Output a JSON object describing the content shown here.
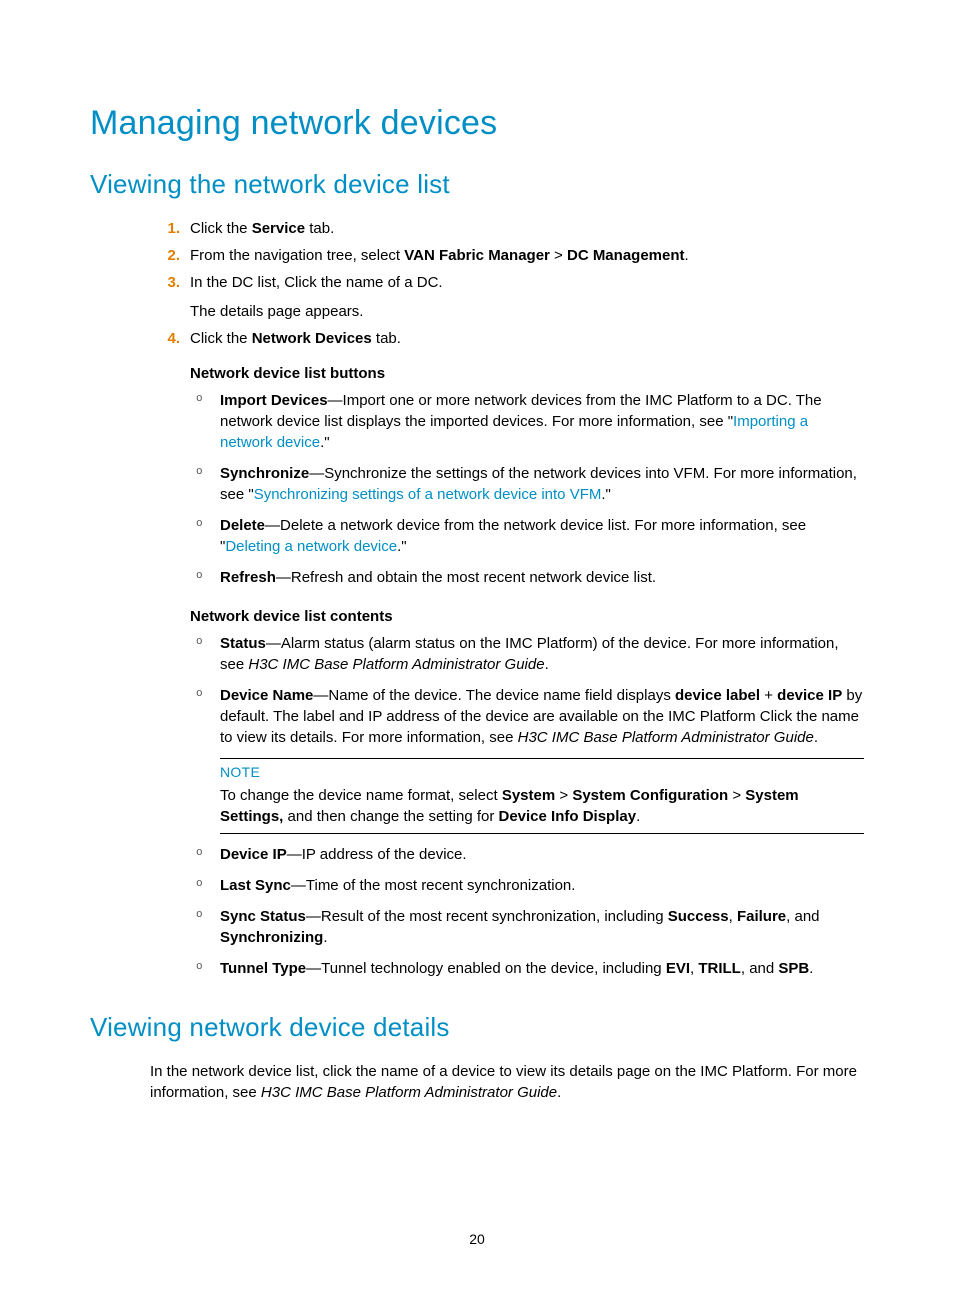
{
  "page_number": "20",
  "h1": "Managing network devices",
  "h2a": "Viewing the network device list",
  "h2b": "Viewing network device details",
  "steps": {
    "n1": "1.",
    "s1a": "Click the ",
    "s1b": "Service",
    "s1c": " tab.",
    "n2": "2.",
    "s2a": "From the navigation tree, select ",
    "s2b": "VAN Fabric Manager",
    "s2c": " > ",
    "s2d": "DC Management",
    "s2e": ".",
    "n3": "3.",
    "s3a": "In the DC list, Click the name of a DC.",
    "s3b": "The details page appears.",
    "n4": "4.",
    "s4a": "Click the ",
    "s4b": "Network Devices",
    "s4c": " tab."
  },
  "buttons_heading": "Network device list buttons",
  "buttons": {
    "b1a": "Import Devices",
    "b1b": "—Import one or more network devices from the IMC Platform to a DC. The network device list displays the imported devices. For more information, see \"",
    "b1c": "Importing a network device",
    "b1d": ".\"",
    "b2a": "Synchronize",
    "b2b": "—Synchronize the settings of the network devices into VFM. For more information, see \"",
    "b2c": "Synchronizing settings of a network device into VFM",
    "b2d": ".\"",
    "b3a": "Delete",
    "b3b": "—Delete a network device from the network device list. For more information, see \"",
    "b3c": "Deleting a network device",
    "b3d": ".\"",
    "b4a": "Refresh",
    "b4b": "—Refresh and obtain the most recent network device list."
  },
  "contents_heading": "Network device list contents",
  "contents": {
    "c1a": "Status",
    "c1b": "—Alarm status (alarm status on the IMC Platform) of the device. For more information, see ",
    "c1c": "H3C IMC Base Platform Administrator Guide",
    "c1d": ".",
    "c2a": "Device Name",
    "c2b": "—Name of the device. The device name field displays ",
    "c2c": "device label",
    "c2d": " + ",
    "c2e": "device IP",
    "c2f": " by default. The label and IP address of the device are available on the IMC Platform Click the name to view its details. For more information, see ",
    "c2g": "H3C IMC Base Platform Administrator Guide",
    "c2h": ".",
    "c3a": "Device IP",
    "c3b": "—IP address of the device.",
    "c4a": "Last Sync",
    "c4b": "—Time of the most recent synchronization.",
    "c5a": "Sync Status",
    "c5b": "—Result of the most recent synchronization, including ",
    "c5c": "Success",
    "c5d": ", ",
    "c5e": "Failure",
    "c5f": ", and ",
    "c5g": "Synchronizing",
    "c5h": ".",
    "c6a": "Tunnel Type",
    "c6b": "—Tunnel technology enabled on the device, including ",
    "c6c": "EVI",
    "c6d": ", ",
    "c6e": "TRILL",
    "c6f": ", and ",
    "c6g": "SPB",
    "c6h": "."
  },
  "note": {
    "label": "NOTE",
    "t1": "To change the device name format, select ",
    "t2": "System",
    "t3": " > ",
    "t4": "System Configuration",
    "t5": " > ",
    "t6": "System Settings,",
    "t7": " and then change the setting for ",
    "t8": "Device Info Display",
    "t9": "."
  },
  "details_para": {
    "p1": "In the network device list, click the name of a device to view its details page on the IMC Platform. For more information, see ",
    "p2": "H3C IMC Base Platform Administrator Guide",
    "p3": "."
  },
  "circ": "o"
}
